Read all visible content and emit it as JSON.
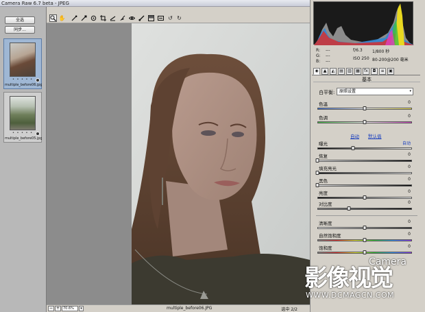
{
  "window": {
    "title": "Camera Raw 6.7 beta - JPEG"
  },
  "filmstrip": {
    "select_all_label": "全选",
    "sync_label": "同步...",
    "thumbnails": [
      {
        "name": "multiple_before06.jpg",
        "dots": "• • • • •",
        "selected": true
      },
      {
        "name": "multiple_before05.jpg",
        "dots": "• • • • •",
        "selected": false
      }
    ]
  },
  "toolbar": {
    "tools": [
      "zoom-icon",
      "hand-icon",
      "white-balance-icon",
      "color-sampler-icon",
      "target-adjust-icon",
      "crop-icon",
      "straighten-icon",
      "spot-removal-icon",
      "red-eye-icon",
      "adjustment-brush-icon",
      "graduated-filter-icon",
      "preferences-icon",
      "rotate-ccw-icon",
      "rotate-cw-icon"
    ]
  },
  "statusbar": {
    "zoom_value": "70.6%",
    "filename": "multiple_before06.JPG",
    "selection_count": "选中 2/2"
  },
  "panel": {
    "readout": {
      "r_label": "R:",
      "g_label": "G:",
      "b_label": "B:",
      "r_value": "---",
      "g_value": "---",
      "b_value": "---",
      "aperture": "f/6.3",
      "shutter": "1/800 秒",
      "iso": "ISO 250",
      "lens": "80-200@200 毫米"
    },
    "section_title": "基本",
    "white_balance": {
      "label": "白平衡:",
      "value": "原照设置"
    },
    "temp": {
      "label": "色温",
      "value": "0",
      "level": 0.5
    },
    "tint": {
      "label": "色调",
      "value": "0",
      "level": 0.5
    },
    "auto_label": "自动",
    "default_label": "默认值",
    "exposure": {
      "label": "曝光",
      "value": "自动",
      "level": 0.38
    },
    "recovery": {
      "label": "恢复",
      "value": "0",
      "level": 0.0
    },
    "fill_light": {
      "label": "填充亮光",
      "value": "0",
      "level": 0.0
    },
    "blacks": {
      "label": "黑色",
      "value": "0",
      "level": 0.0
    },
    "brightness": {
      "label": "亮度",
      "value": "0",
      "level": 0.5
    },
    "contrast": {
      "label": "对比度",
      "value": "0",
      "level": 0.33
    },
    "clarity": {
      "label": "清晰度",
      "value": "0",
      "level": 0.5
    },
    "vibrance": {
      "label": "自然饱和度",
      "value": "0",
      "level": 0.5
    },
    "saturation": {
      "label": "饱和度",
      "value": "0",
      "level": 0.5
    }
  },
  "watermark": {
    "brand_text": "影像视觉",
    "brand_en": "Camera",
    "url": "WWW.DCMAGCN.COM"
  }
}
